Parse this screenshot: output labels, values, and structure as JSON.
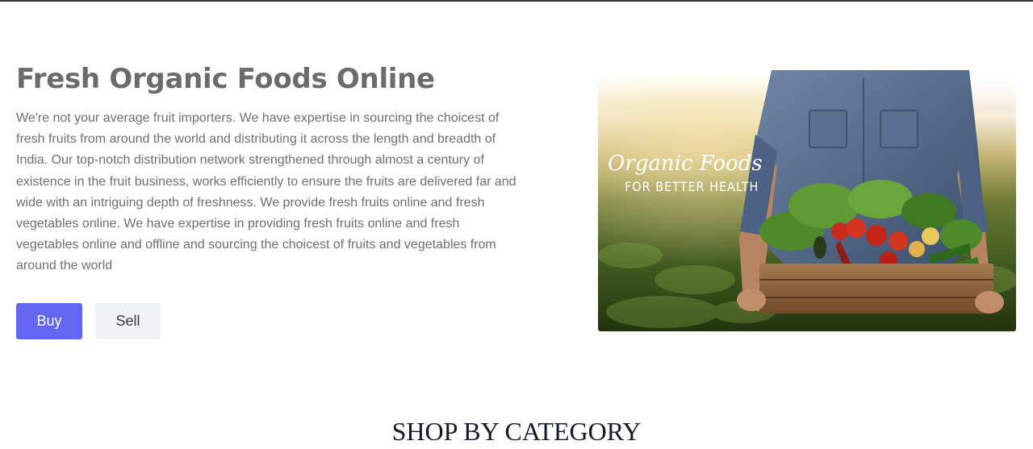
{
  "hero": {
    "title": "Fresh Organic Foods Online",
    "description": "We're not your average fruit importers. We have expertise in sourcing the choicest of fresh fruits from around the world and distributing it across the length and breadth of India. Our top-notch distribution network strengthened through almost a century of existence in the fruit business, works efficiently to ensure the fruits are delivered far and wide with an intriguing depth of freshness. We provide fresh fruits online and fresh vegetables online. We have expertise in providing fresh fruits online and fresh vegetables online and offline and sourcing the choicest of fruits and vegetables from around the world",
    "buy_label": "Buy",
    "sell_label": "Sell"
  },
  "banner": {
    "title": "Organic Foods",
    "subtitle": "FOR BETTER HEALTH"
  },
  "sections": {
    "shop_by_category": "SHOP BY CATEGORY"
  },
  "colors": {
    "accent": "#6366f1",
    "heading": "#6b6b6b",
    "body_text": "#6f6f6f",
    "secondary_button": "#f1f2f4"
  }
}
